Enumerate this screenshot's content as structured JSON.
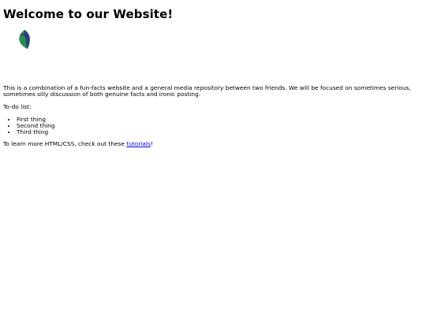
{
  "heading": "Welcome to our Website!",
  "logo": {
    "icon": "leaf-icon",
    "colors": [
      "#2e8b57",
      "#1f3f8a",
      "#6a1f7a"
    ]
  },
  "intro": "This is a combination of a fun-facts website and a general media repository between two friends. We will be focused on sometimes serious, sometimes silly discussion of both genuine facts and ironic posting.",
  "todo": {
    "label": "To-do list:",
    "items": [
      "First thing",
      "Second thing",
      "Third thing"
    ]
  },
  "learn_more": {
    "prefix": "To learn more HTML/CSS, check out these ",
    "link_text": "tutorials",
    "suffix": "!",
    "link_color": "#0000ee"
  }
}
